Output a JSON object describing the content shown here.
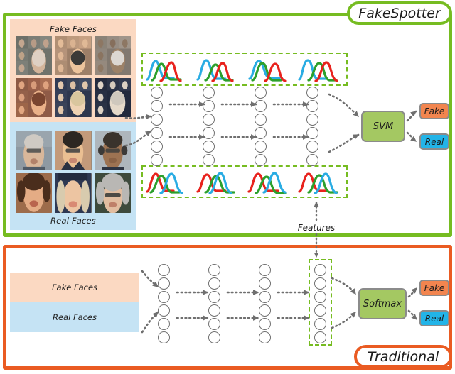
{
  "figure": {
    "top_frame_label": "FakeSpotter",
    "bottom_frame_label": "Traditional",
    "top_frame_color": "#76bc21",
    "bottom_frame_color": "#ea5b22"
  },
  "fakespotter": {
    "inputs": {
      "fake_panel_label": "Fake Faces",
      "fake_panel_color": "#fbd9c2",
      "real_panel_label": "Real Faces",
      "real_panel_color": "#c5e3f4",
      "fake_face_count": 6,
      "real_face_count": 6
    },
    "network": {
      "layer_count": 4,
      "neurons_per_layer": 6
    },
    "distributions": {
      "top_group_count": 4,
      "bottom_group_count": 4,
      "curves_per_group": 3,
      "curve_colors": [
        "#29ace3",
        "#2ca02c",
        "#e8221d"
      ],
      "box_border_color": "#76bc21"
    },
    "classifier": {
      "label": "SVM",
      "color": "#a4c862"
    },
    "outputs": [
      {
        "label": "Fake",
        "color": "#f2854f"
      },
      {
        "label": "Real",
        "color": "#22b4e8"
      }
    ]
  },
  "features_label": "Features",
  "traditional": {
    "inputs": [
      {
        "label": "Fake Faces",
        "color": "#fbd9c2"
      },
      {
        "label": "Real Faces",
        "color": "#c5e3f4"
      }
    ],
    "network": {
      "layer_count": 4,
      "neurons_per_layer": 6,
      "highlighted_layer_index": 4,
      "highlight_border_color": "#76bc21"
    },
    "classifier": {
      "label": "Softmax",
      "color": "#a4c862"
    },
    "outputs": [
      {
        "label": "Fake",
        "color": "#f2854f"
      },
      {
        "label": "Real",
        "color": "#22b4e8"
      }
    ]
  }
}
